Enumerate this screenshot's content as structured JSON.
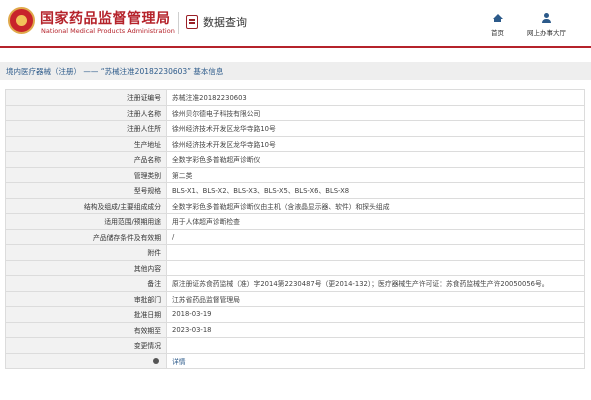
{
  "header": {
    "site_title": "国家药品监督管理局",
    "site_subtitle": "National Medical Products Administration",
    "section_title": "数据查询",
    "nav": {
      "home_label": "首页",
      "service_label": "网上办事大厅"
    }
  },
  "breadcrumb": {
    "parent": "境内医疗器械（注册）",
    "separator": "——",
    "current": "“苏械注准20182230603” 基本信息"
  },
  "detail_rows": [
    {
      "label": "注册证编号",
      "value": "苏械注准20182230603"
    },
    {
      "label": "注册人名称",
      "value": "徐州贝尔德电子科技有限公司"
    },
    {
      "label": "注册人住所",
      "value": "徐州经济技术开发区龙华寺路10号"
    },
    {
      "label": "生产地址",
      "value": "徐州经济技术开发区龙华寺路10号"
    },
    {
      "label": "产品名称",
      "value": "全数字彩色多普勒超声诊断仪"
    },
    {
      "label": "管理类别",
      "value": "第二类"
    },
    {
      "label": "型号规格",
      "value": "BLS-X1、BLS-X2、BLS-X3、BLS-X5、BLS-X6、BLS-X8"
    },
    {
      "label": "结构及组成/主要组成成分",
      "value": "全数字彩色多普勒超声诊断仪由主机（含液晶显示器、软件）和探头组成"
    },
    {
      "label": "适用范围/预期用途",
      "value": "用于人体超声诊断检查"
    },
    {
      "label": "产品储存条件及有效期",
      "value": "/"
    },
    {
      "label": "附件",
      "value": ""
    },
    {
      "label": "其他内容",
      "value": ""
    },
    {
      "label": "备注",
      "value": "原注册证苏食药监械（准）字2014第2230487号（更2014-132）；医疗器械生产许可证：苏食药监械生产许20050056号。"
    },
    {
      "label": "审批部门",
      "value": "江苏省药品监督管理局"
    },
    {
      "label": "批准日期",
      "value": "2018-03-19"
    },
    {
      "label": "有效期至",
      "value": "2023-03-18"
    },
    {
      "label": "变更情况",
      "value": ""
    }
  ],
  "detail_link": {
    "label": "",
    "value": "详情"
  },
  "colors": {
    "brand_red": "#b5232b",
    "link_blue": "#2c5a8a",
    "label_bg": "#f2f2f2"
  },
  "icons": {
    "logo": "emblem-logo",
    "database": "database-icon",
    "home": "home-icon",
    "user": "user-icon",
    "info": "info-icon"
  }
}
